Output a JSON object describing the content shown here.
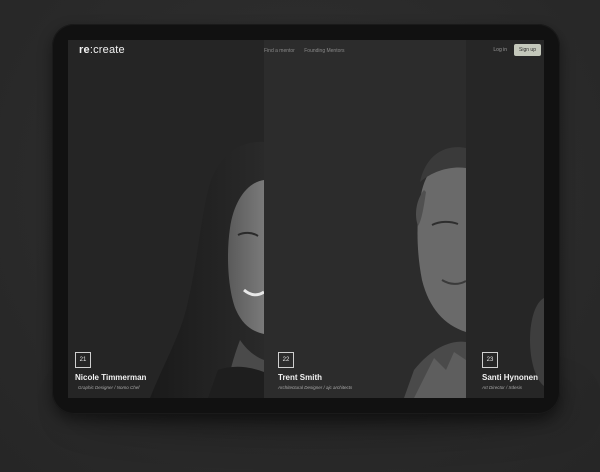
{
  "nav": {
    "logo_bold": "re",
    "logo_rest": ":create",
    "links": [
      "Find a mentor",
      "Founding Mentors"
    ],
    "login": "Log in",
    "signup": "Sign up"
  },
  "mentors": [
    {
      "number": "21",
      "name": "Nicole Timmerman",
      "role": "Graphic Designer / Nomo Chef"
    },
    {
      "number": "22",
      "name": "Trent Smith",
      "role": "Architectural Designer / ajc architects"
    },
    {
      "number": "23",
      "name": "Santi Hynonen",
      "role": "Art Director / Xdesis"
    }
  ],
  "colors": {
    "background": "#2b2b2b",
    "device": "#111111",
    "signup_button": "#c4c8bb"
  }
}
